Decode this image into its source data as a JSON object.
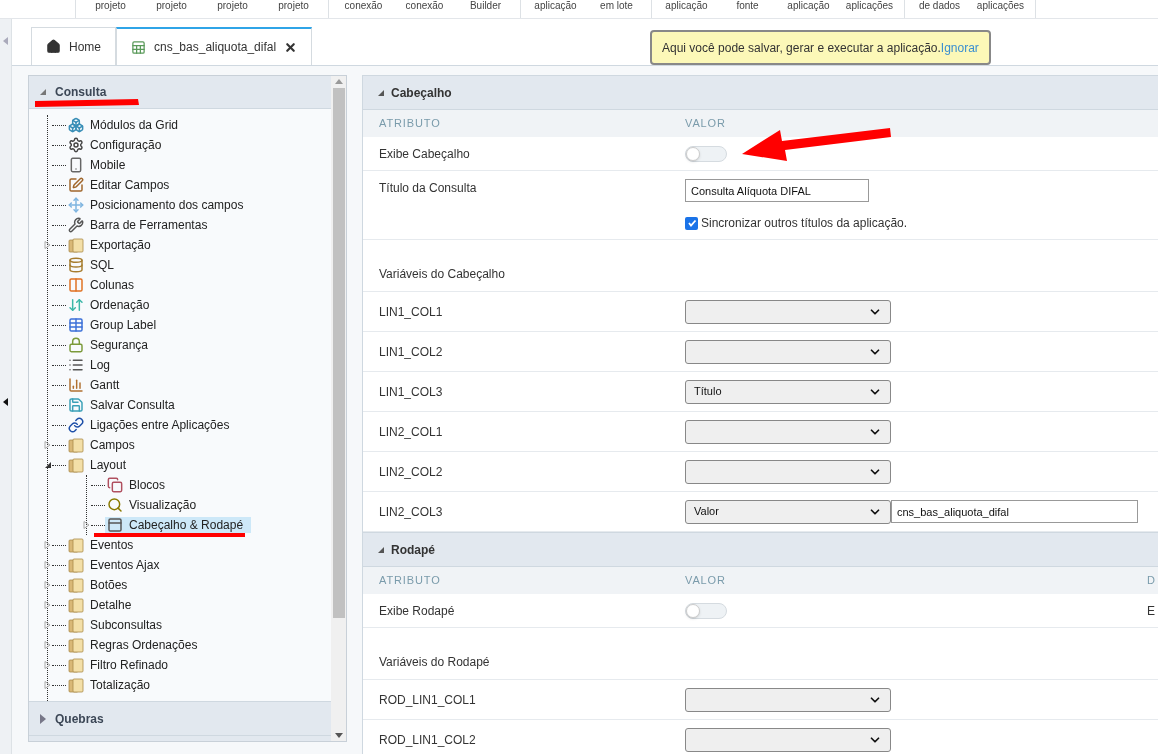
{
  "toolbar": {
    "groups": [
      [
        "projeto",
        "projeto",
        "projeto",
        "projeto"
      ],
      [
        "conexão",
        "conexão",
        "Builder"
      ],
      [
        "aplicação",
        "em lote"
      ],
      [
        "aplicação",
        "fonte",
        "aplicação",
        "aplicações"
      ],
      [
        "de dados",
        "aplicações"
      ]
    ]
  },
  "tabs": [
    {
      "label": "Home",
      "kind": "home",
      "selected": false
    },
    {
      "label": "cns_bas_aliquota_difal",
      "kind": "grid",
      "selected": true
    }
  ],
  "tooltip": {
    "text": "Aqui você pode salvar, gerar e executar a aplicação.",
    "link": "Ignorar"
  },
  "tree": {
    "title": "Consulta",
    "expanded": true,
    "items": [
      {
        "label": "Módulos da Grid",
        "kind": "page",
        "selected": false
      },
      {
        "label": "Configuração",
        "kind": "page",
        "selected": false
      },
      {
        "label": "Mobile",
        "kind": "page",
        "selected": false
      },
      {
        "label": "Editar Campos",
        "kind": "page",
        "selected": false
      },
      {
        "label": "Posicionamento dos campos",
        "kind": "page",
        "selected": false
      },
      {
        "label": "Barra de Ferramentas",
        "kind": "page",
        "selected": false
      },
      {
        "label": "Exportação",
        "kind": "folder",
        "expanded": false,
        "selected": false
      },
      {
        "label": "SQL",
        "kind": "page",
        "selected": false
      },
      {
        "label": "Colunas",
        "kind": "page",
        "selected": false
      },
      {
        "label": "Ordenação",
        "kind": "page",
        "selected": false
      },
      {
        "label": "Group Label",
        "kind": "page",
        "selected": false
      },
      {
        "label": "Segurança",
        "kind": "page",
        "selected": false
      },
      {
        "label": "Log",
        "kind": "page",
        "selected": false
      },
      {
        "label": "Gantt",
        "kind": "page",
        "selected": false
      },
      {
        "label": "Salvar Consulta",
        "kind": "page",
        "selected": false
      },
      {
        "label": "Ligações entre Aplicações",
        "kind": "page",
        "selected": false
      },
      {
        "label": "Campos",
        "kind": "folder",
        "expanded": false,
        "selected": false
      },
      {
        "label": "Layout",
        "kind": "folder",
        "expanded": true,
        "selected": false,
        "children": [
          {
            "label": "Blocos",
            "kind": "page",
            "selected": false
          },
          {
            "label": "Visualização",
            "kind": "page",
            "selected": false
          },
          {
            "label": "Cabeçalho & Rodapé",
            "kind": "page",
            "expanded": false,
            "selected": true
          }
        ]
      },
      {
        "label": "Eventos",
        "kind": "folder",
        "expanded": false,
        "selected": false
      },
      {
        "label": "Eventos Ajax",
        "kind": "folder",
        "expanded": false,
        "selected": false
      },
      {
        "label": "Botões",
        "kind": "folder",
        "expanded": false,
        "selected": false
      },
      {
        "label": "Detalhe",
        "kind": "folder",
        "expanded": false,
        "selected": false
      },
      {
        "label": "Subconsultas",
        "kind": "folder",
        "expanded": false,
        "selected": false
      },
      {
        "label": "Regras Ordenações",
        "kind": "folder",
        "expanded": false,
        "selected": false
      },
      {
        "label": "Filtro Refinado",
        "kind": "folder",
        "expanded": false,
        "selected": false
      },
      {
        "label": "Totalização",
        "kind": "folder",
        "expanded": false,
        "selected": false
      }
    ]
  },
  "footer_section": {
    "title": "Quebras",
    "expanded": false
  },
  "sections": [
    {
      "title": "Cabeçalho",
      "expanded": true,
      "columns": [
        "ATRIBUTO",
        "VALOR"
      ],
      "rows": [
        {
          "kind": "toggle",
          "label": "Exibe Cabeçalho",
          "on": false
        },
        {
          "kind": "text",
          "label": "Título da Consulta",
          "value": "Consulta Alíquota DIFAL",
          "checkbox": {
            "label": "Sincronizar outros títulos da aplicação.",
            "checked": true
          }
        },
        {
          "kind": "heading",
          "label": "Variáveis do Cabeçalho"
        },
        {
          "kind": "select",
          "label": "LIN1_COL1"
        },
        {
          "kind": "select",
          "label": "LIN1_COL2"
        },
        {
          "kind": "select",
          "label": "LIN1_COL3",
          "value": "Título"
        },
        {
          "kind": "select",
          "label": "LIN2_COL1"
        },
        {
          "kind": "select",
          "label": "LIN2_COL2"
        },
        {
          "kind": "select",
          "label": "LIN2_COL3",
          "value": "Valor",
          "text": "cns_bas_aliquota_difal"
        }
      ]
    },
    {
      "title": "Rodapé",
      "expanded": true,
      "columns": [
        "ATRIBUTO",
        "VALOR",
        "D"
      ],
      "rows": [
        {
          "kind": "toggle",
          "label": "Exibe Rodapé",
          "on": false,
          "column_3": "E"
        },
        {
          "kind": "heading",
          "label": "Variáveis do Rodapé"
        },
        {
          "kind": "select",
          "label": "ROD_LIN1_COL1"
        },
        {
          "kind": "select",
          "label": "ROD_LIN1_COL2"
        }
      ]
    }
  ]
}
